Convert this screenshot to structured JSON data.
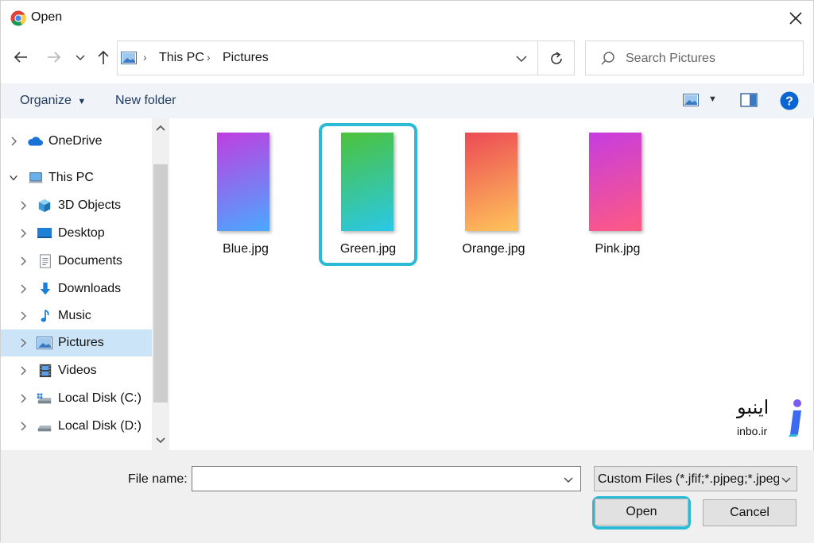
{
  "window": {
    "title": "Open",
    "app_icon": "chrome-icon"
  },
  "nav": {
    "back_icon": "arrow-left-icon",
    "forward_icon": "arrow-right-icon",
    "recent_icon": "chevron-down-icon",
    "up_icon": "arrow-up-icon"
  },
  "address": {
    "breadcrumbs": [
      {
        "label": "This PC"
      },
      {
        "label": "Pictures"
      }
    ]
  },
  "search": {
    "placeholder": "Search Pictures"
  },
  "toolbar": {
    "organize_label": "Organize",
    "new_folder_label": "New folder"
  },
  "sidebar": {
    "items": [
      {
        "label": "OneDrive",
        "icon": "cloud-icon"
      },
      {
        "label": "This PC",
        "icon": "computer-icon"
      },
      {
        "label": "3D Objects",
        "icon": "cube-icon"
      },
      {
        "label": "Desktop",
        "icon": "desktop-icon"
      },
      {
        "label": "Documents",
        "icon": "document-icon"
      },
      {
        "label": "Downloads",
        "icon": "download-icon"
      },
      {
        "label": "Music",
        "icon": "music-icon"
      },
      {
        "label": "Pictures",
        "icon": "pictures-icon",
        "selected": true
      },
      {
        "label": "Videos",
        "icon": "film-icon"
      },
      {
        "label": "Local Disk (C:)",
        "icon": "drive-icon"
      },
      {
        "label": "Local Disk (D:)",
        "icon": "drive-icon"
      }
    ]
  },
  "files": [
    {
      "name": "Blue.jpg",
      "gradient": [
        "#c03ee0",
        "#4aa8ff"
      ]
    },
    {
      "name": "Green.jpg",
      "gradient": [
        "#4cc23a",
        "#2ac8e8"
      ],
      "highlighted": true
    },
    {
      "name": "Orange.jpg",
      "gradient": [
        "#ec4a55",
        "#ffc45a"
      ]
    },
    {
      "name": "Pink.jpg",
      "gradient": [
        "#c63ce0",
        "#ff5a82"
      ]
    }
  ],
  "watermark": {
    "text_fa": "اینبو",
    "text_en": "inbo.ir"
  },
  "footer": {
    "file_name_label": "File name:",
    "file_name_value": "",
    "filter_value": "Custom Files (*.jfif;*.pjpeg;*.jpeg",
    "open_label": "Open",
    "cancel_label": "Cancel"
  },
  "colors": {
    "highlight": "#2bbad6",
    "selected_bg": "#cce4f7",
    "help_blue": "#0a64d2"
  }
}
